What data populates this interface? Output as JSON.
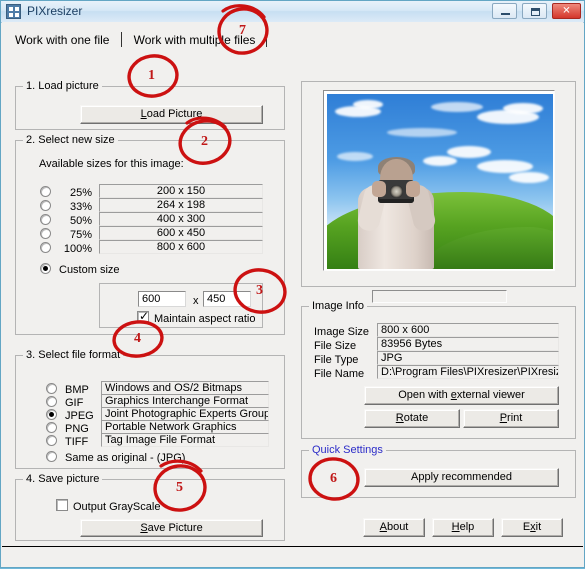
{
  "window": {
    "title": "PIXresizer",
    "icon": "app-grid-icon",
    "minimize_label": "Minimize",
    "maximize_label": "Maximize",
    "close_label": "Close"
  },
  "tabs": [
    {
      "label": "Work with one file",
      "active": true
    },
    {
      "label": "Work with multiple files",
      "active": false
    }
  ],
  "load_picture": {
    "caption": "1. Load picture",
    "button_label": "Load Picture",
    "button_accel": "L"
  },
  "select_size": {
    "caption": "2. Select new size",
    "available_label": "Available sizes for this image:",
    "options": [
      {
        "percent": "25%",
        "dimensions": "200 x 150",
        "selected": false
      },
      {
        "percent": "33%",
        "dimensions": "264 x 198",
        "selected": false
      },
      {
        "percent": "50%",
        "dimensions": "400 x 300",
        "selected": false
      },
      {
        "percent": "75%",
        "dimensions": "600 x 450",
        "selected": false
      },
      {
        "percent": "100%",
        "dimensions": "800 x 600",
        "selected": false
      }
    ],
    "custom_label": "Custom size",
    "custom_selected": true,
    "custom_width": "600",
    "custom_times": "x",
    "custom_height": "450",
    "maintain_aspect_label": "Maintain aspect ratio",
    "maintain_aspect_checked": true
  },
  "file_format": {
    "caption": "3. Select file format",
    "options": [
      {
        "name": "BMP",
        "description": "Windows and OS/2 Bitmaps",
        "selected": false
      },
      {
        "name": "GIF",
        "description": "Graphics Interchange Format",
        "selected": false
      },
      {
        "name": "JPEG",
        "description": "Joint Photographic Experts Group",
        "selected": true
      },
      {
        "name": "PNG",
        "description": "Portable Network Graphics",
        "selected": false
      },
      {
        "name": "TIFF",
        "description": "Tag Image File Format",
        "selected": false
      }
    ],
    "same_as_original_label": "Same as original  - (JPG)",
    "same_as_original_selected": false
  },
  "save_picture": {
    "caption": "4. Save picture",
    "grayscale_label": "Output GrayScale",
    "grayscale_checked": false,
    "button_label": "Save Picture",
    "button_accel": "S"
  },
  "image_info": {
    "caption": "Image Info",
    "rows": [
      {
        "label": "Image Size",
        "value": "800 x 600"
      },
      {
        "label": "File Size",
        "value": "83956 Bytes"
      },
      {
        "label": "File Type",
        "value": "JPG"
      },
      {
        "label": "File Name",
        "value": "D:\\Program Files\\PIXresizer\\PIXresiz"
      }
    ],
    "open_viewer_label": "Open with external viewer",
    "open_viewer_accel": "e",
    "rotate_label": "Rotate",
    "rotate_accel": "R",
    "print_label": "Print",
    "print_accel": "P"
  },
  "quick_settings": {
    "caption": "Quick Settings",
    "caption_color": "#2c2cc8",
    "button_label": "Apply recommended"
  },
  "bottom_buttons": [
    {
      "label": "About",
      "accel": "A"
    },
    {
      "label": "Help",
      "accel": "H"
    },
    {
      "label": "Exit",
      "accel": "x"
    }
  ],
  "annotations": {
    "color": "#cc1111",
    "markers": [
      {
        "id": "1",
        "target": "Load Picture button"
      },
      {
        "id": "2",
        "target": "Select new size group"
      },
      {
        "id": "3",
        "target": "Custom size fields"
      },
      {
        "id": "4",
        "target": "Select file format group"
      },
      {
        "id": "5",
        "target": "Save picture group"
      },
      {
        "id": "6",
        "target": "Quick Settings group"
      },
      {
        "id": "7",
        "target": "Work with multiple files tab"
      }
    ]
  }
}
